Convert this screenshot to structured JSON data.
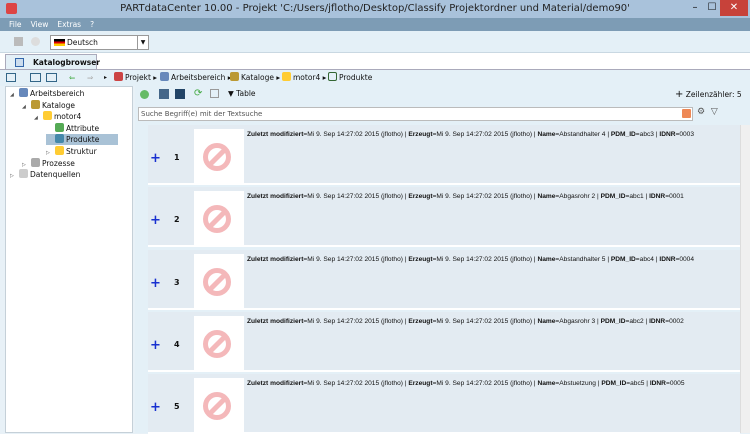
{
  "window": {
    "title": "PARTdataCenter 10.00 - Projekt 'C:/Users/jflotho/Desktop/Classify Projektordner und Material/demo90'",
    "minimize": "–",
    "maximize": "☐",
    "close": "✕"
  },
  "menu": [
    "File",
    "View",
    "Extras",
    "?"
  ],
  "language": "Deutsch",
  "tab": "Katalogbrowser",
  "breadcrumb": [
    "Projekt",
    "Arbeitsbereich",
    "Kataloge",
    "motor4",
    "Produkte"
  ],
  "tree": [
    {
      "label": "Arbeitsbereich",
      "level": 0,
      "arrow": "◢"
    },
    {
      "label": "Kataloge",
      "level": 1,
      "arrow": "◢"
    },
    {
      "label": "motor4",
      "level": 2,
      "arrow": "◢"
    },
    {
      "label": "Attribute",
      "level": 3,
      "arrow": ""
    },
    {
      "label": "Produkte",
      "level": 3,
      "arrow": ""
    },
    {
      "label": "Struktur",
      "level": 3,
      "arrow": "▷"
    },
    {
      "label": "Prozesse",
      "level": 1,
      "arrow": "▷"
    },
    {
      "label": "Datenquellen",
      "level": 0,
      "arrow": "▷"
    }
  ],
  "content": {
    "view_label": "Table",
    "row_counter": "Zeilenzähler: 5",
    "search_placeholder": "Suche Begriff(e) mit der Textsuche"
  },
  "rows": [
    {
      "n": "1",
      "modified": "Mi 9. Sep 14:27:02 2015 (jflotho)",
      "created": "Mi 9. Sep 14:27:02 2015 (jflotho)",
      "name": "Abstandhalter 4",
      "pdm": "abc3",
      "idnr": "0003"
    },
    {
      "n": "2",
      "modified": "Mi 9. Sep 14:27:02 2015 (jflotho)",
      "created": "Mi 9. Sep 14:27:02 2015 (jflotho)",
      "name": "Abgasrohr 2",
      "pdm": "abc1",
      "idnr": "0001"
    },
    {
      "n": "3",
      "modified": "Mi 9. Sep 14:27:02 2015 (jflotho)",
      "created": "Mi 9. Sep 14:27:02 2015 (jflotho)",
      "name": "Abstandhalter 5",
      "pdm": "abc4",
      "idnr": "0004"
    },
    {
      "n": "4",
      "modified": "Mi 9. Sep 14:27:02 2015 (jflotho)",
      "created": "Mi 9. Sep 14:27:02 2015 (jflotho)",
      "name": "Abgasrohr 3",
      "pdm": "abc2",
      "idnr": "0002"
    },
    {
      "n": "5",
      "modified": "Mi 9. Sep 14:27:02 2015 (jflotho)",
      "created": "Mi 9. Sep 14:27:02 2015 (jflotho)",
      "name": "Abstuetzung",
      "pdm": "abc5",
      "idnr": "0005"
    }
  ],
  "labels": {
    "modified": "Zuletzt modifiziert",
    "created": "Erzeugt",
    "name": "Name",
    "pdm": "PDM_ID",
    "idnr": "IDNR"
  }
}
